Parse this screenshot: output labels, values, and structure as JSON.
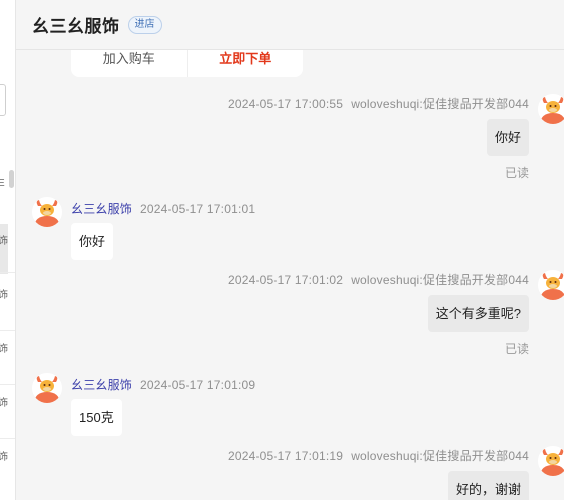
{
  "header": {
    "shop_name": "幺三幺服饰",
    "badge": "进店"
  },
  "card": {
    "left_label": "加入购车",
    "right_label": "立即下单"
  },
  "left_fragments": [
    "E",
    "饰",
    "饰",
    "饰",
    "饰",
    "饰"
  ],
  "messages": [
    {
      "sender": "woloveshuqi:促佳搜品开发部044",
      "time": "2024-05-17 17:00:55",
      "text": "你好",
      "status": "已读"
    },
    {
      "sender": "幺三幺服饰",
      "time": "2024-05-17 17:01:01",
      "text": "你好"
    },
    {
      "sender": "woloveshuqi:促佳搜品开发部044",
      "time": "2024-05-17 17:01:02",
      "text": "这个有多重呢?",
      "status": "已读"
    },
    {
      "sender": "幺三幺服饰",
      "time": "2024-05-17 17:01:09",
      "text": "150克"
    },
    {
      "sender": "woloveshuqi:促佳搜品开发部044",
      "time": "2024-05-17 17:01:19",
      "text": "好的，谢谢"
    }
  ],
  "colors": {
    "sender_shop": "#3b3faa",
    "order_red": "#e2381b",
    "avatar_orange": "#f0714a"
  }
}
